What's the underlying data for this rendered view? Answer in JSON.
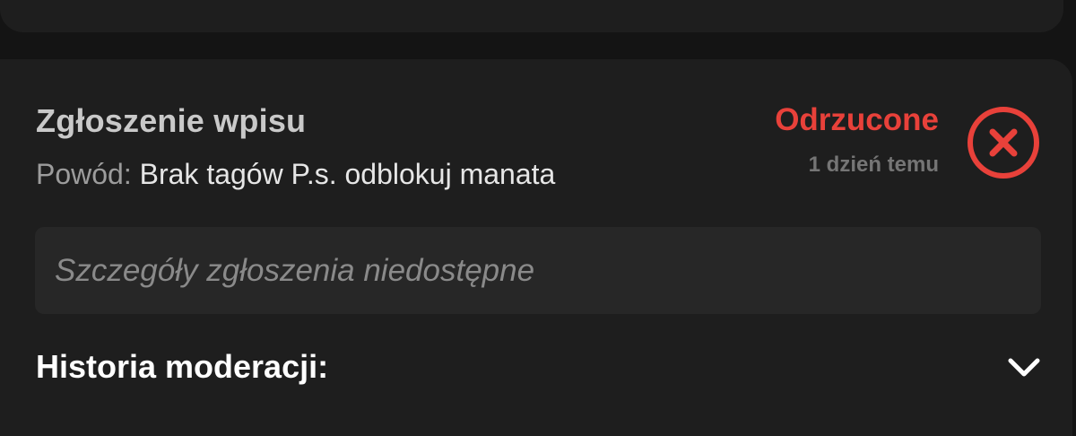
{
  "report": {
    "title": "Zgłoszenie wpisu",
    "reason_label": "Powód: ",
    "reason_text": "Brak tagów P.s. odblokuj manata",
    "status": "Odrzucone",
    "time_ago": "1 dzień temu",
    "status_icon": "close-circle-icon",
    "details_placeholder": "Szczegóły zgłoszenia niedostępne"
  },
  "moderation_history": {
    "label": "Historia moderacji:",
    "toggle_icon": "chevron-down-icon"
  },
  "colors": {
    "background": "#141414",
    "card": "#1e1e1e",
    "details_box": "#272727",
    "status_rejected": "#e8413a"
  }
}
